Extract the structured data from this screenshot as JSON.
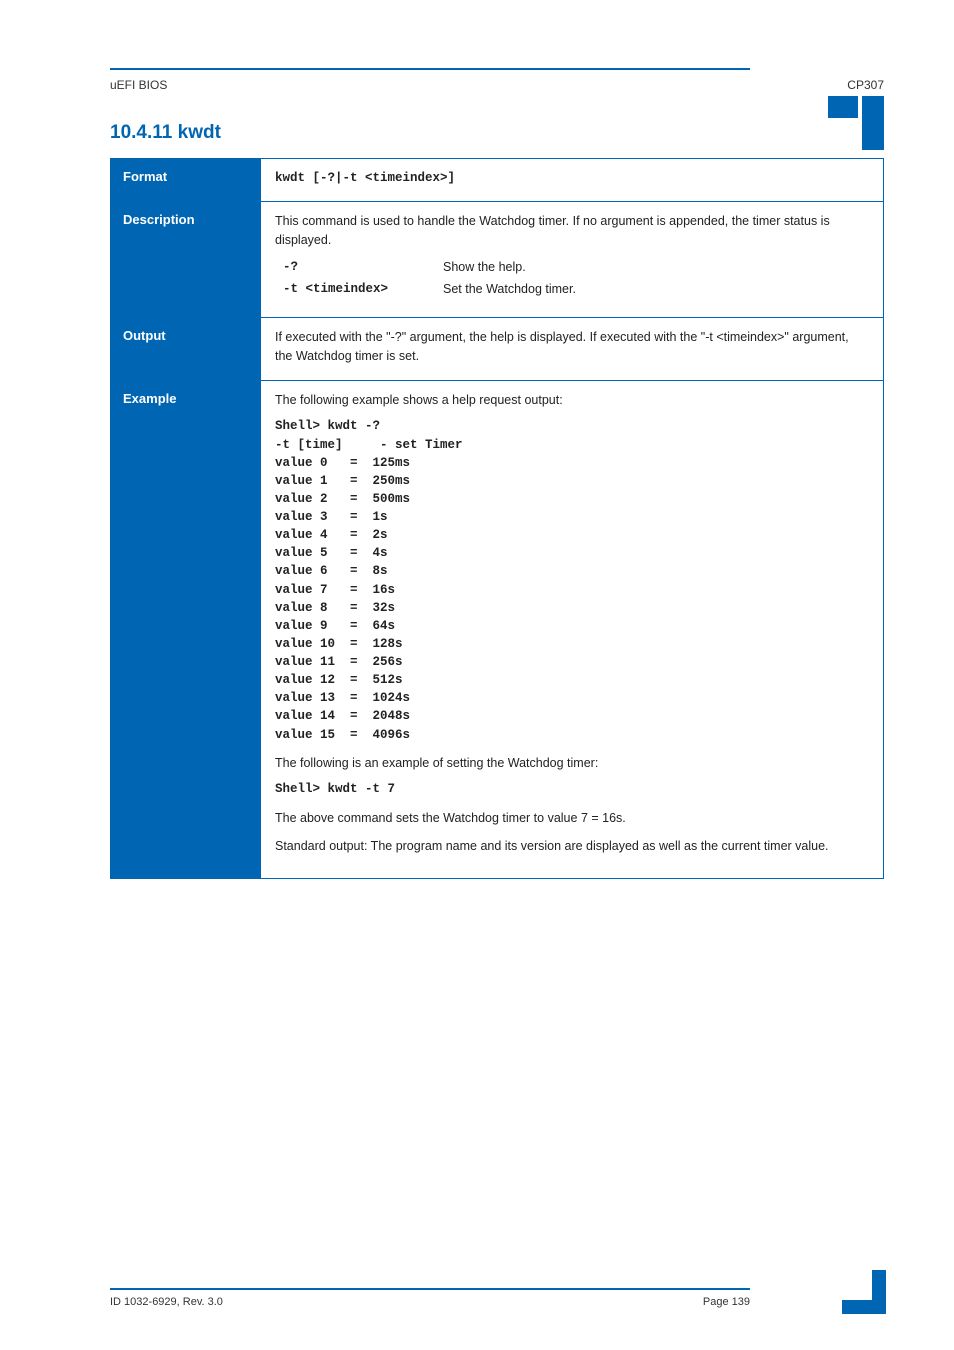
{
  "header": {
    "left": "uEFI BIOS",
    "right": "CP307"
  },
  "corner_icon": "page-corner-icon",
  "section_title": "10.4.11 kwdt",
  "rows": {
    "format": {
      "label": "Format",
      "code": "kwdt [-?|-t <timeindex>]"
    },
    "description": {
      "label": "Description",
      "intro": "This command is used to handle the Watchdog timer. If no argument is appended, the timer status is displayed.",
      "items": [
        {
          "code": "-?",
          "text": "Show the help."
        },
        {
          "code": "-t <timeindex>",
          "text": "Set the Watchdog timer."
        }
      ]
    },
    "output": {
      "label": "Output",
      "text": "If executed with the \"-?\" argument, the help is displayed. If executed with the \"-t <timeindex>\" argument, the Watchdog timer is set."
    },
    "example": {
      "label": "Example",
      "intro": "The following example shows a help request output:",
      "help_block": "Shell> kwdt -?\n-t [time]     - set Timer\nvalue 0   =  125ms\nvalue 1   =  250ms\nvalue 2   =  500ms\nvalue 3   =  1s\nvalue 4   =  2s\nvalue 5   =  4s\nvalue 6   =  8s\nvalue 7   =  16s\nvalue 8   =  32s\nvalue 9   =  64s\nvalue 10  =  128s\nvalue 11  =  256s\nvalue 12  =  512s\nvalue 13  =  1024s\nvalue 14  =  2048s\nvalue 15  =  4096s",
      "set_intro": "The following is an example of setting the Watchdog timer:",
      "set_block": "Shell> kwdt -t 7",
      "set_note": "The above command sets the Watchdog timer to value 7 = 16s.",
      "std_note": "Standard output: The program name and its version are displayed as well as the current timer value."
    }
  },
  "footer": {
    "left": "ID 1032-6929, Rev. 3.0",
    "right": "Page  139"
  }
}
